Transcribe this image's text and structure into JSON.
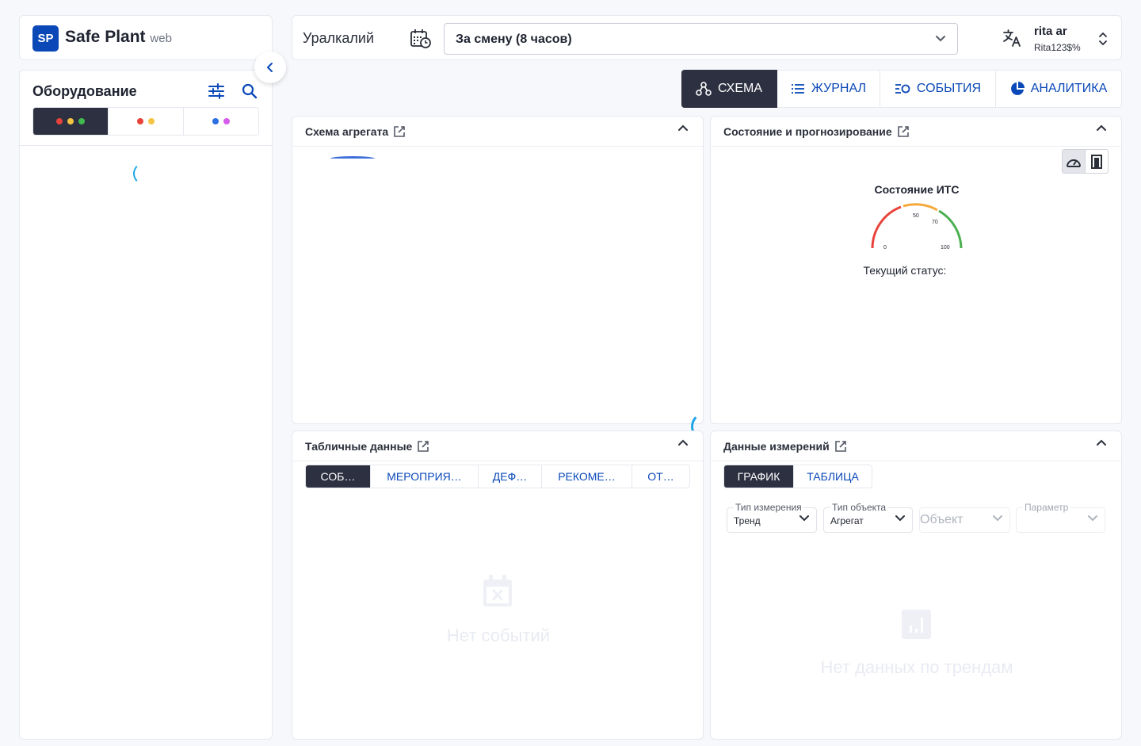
{
  "brand": {
    "badge": "SP",
    "name": "Safe Plant",
    "suffix": "web"
  },
  "equipment": {
    "title": "Оборудование",
    "tabs": [
      {
        "dots": [
          "#e8433b",
          "#f5c443",
          "#3fb950"
        ]
      },
      {
        "dots": [
          "#e8433b",
          "#f5c443"
        ]
      },
      {
        "dots": [
          "#2f6fe4",
          "#d45ce8"
        ]
      }
    ]
  },
  "header": {
    "company": "Уралкалий",
    "period": "За смену (8 часов)",
    "user": {
      "name": "rita ar",
      "login": "Rita123$%"
    }
  },
  "nav": {
    "tabs": [
      {
        "label": "СХЕМА",
        "icon": "schema-icon",
        "active": true
      },
      {
        "label": "ЖУРНАЛ",
        "icon": "list-icon"
      },
      {
        "label": "СОБЫТИЯ",
        "icon": "events-icon"
      },
      {
        "label": "АНАЛИТИКА",
        "icon": "pie-chart-icon"
      }
    ]
  },
  "schema_panel": {
    "title": "Схема агрегата"
  },
  "state_panel": {
    "title": "Состояние и прогнозирование",
    "gauge_title": "Состояние ИТС",
    "gauge_ticks": [
      "0",
      "50",
      "70",
      "100"
    ],
    "status_label": "Текущий статус:"
  },
  "table_panel": {
    "title": "Табличные данные",
    "tabs": [
      "СОБ…",
      "МЕРОПРИЯ…",
      "ДЕФ…",
      "РЕКОМЕ…",
      "ОТ…"
    ],
    "empty": "Нет событий"
  },
  "measure_panel": {
    "title": "Данные измерений",
    "tabs": [
      "ГРАФИК",
      "ТАБЛИЦА"
    ],
    "fields": {
      "measure_type": {
        "label": "Тип измерения",
        "value": "Тренд"
      },
      "object_type": {
        "label": "Тип объекта",
        "value": "Агрегат"
      },
      "object": {
        "placeholder": "Объект"
      },
      "param": {
        "label": "Параметр"
      }
    },
    "empty": "Нет данных по трендам"
  },
  "colors": {
    "accent": "#0a48b8",
    "dark": "#2d3040",
    "spinner": "#1ea7e8"
  }
}
